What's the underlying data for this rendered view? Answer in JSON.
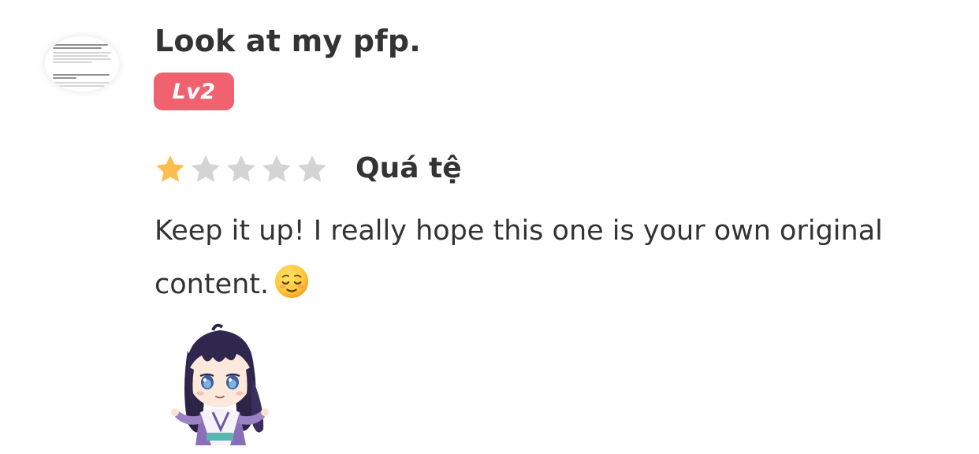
{
  "review": {
    "username": "Look at my pfp.",
    "level_badge": "Lv2",
    "rating": {
      "value": 1,
      "max": 5,
      "label": "Quá tệ",
      "filled_color": "#FDBE4F",
      "empty_color": "#D4D4D4"
    },
    "comment": "Keep it up! I really hope this one is your own original content.",
    "comment_emoji": "relieved-face-emoji",
    "sticker": "chibi-girl-shrug-sticker"
  },
  "colors": {
    "badge": "#F06270",
    "text": "#333333"
  }
}
